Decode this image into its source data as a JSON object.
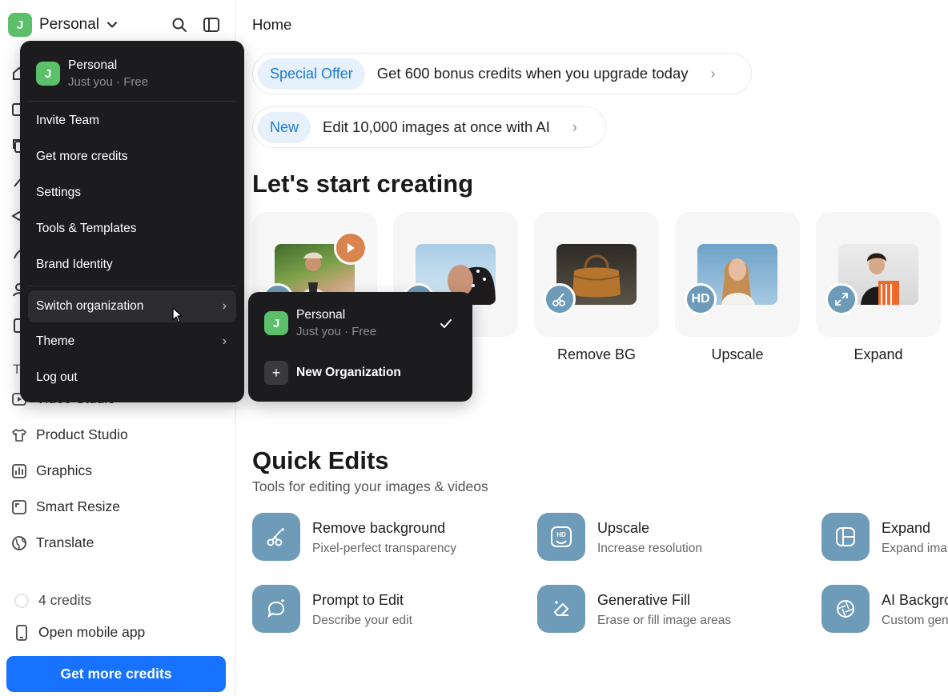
{
  "header": {
    "workspace_initial": "J",
    "workspace_name": "Personal"
  },
  "sidebar": {
    "visible_items": [
      {
        "label": "Video Studio",
        "icon": "video-icon"
      },
      {
        "label": "Product Studio",
        "icon": "shirt-icon"
      },
      {
        "label": "Graphics",
        "icon": "chart-icon"
      },
      {
        "label": "Smart Resize",
        "icon": "resize-icon"
      },
      {
        "label": "Translate",
        "icon": "globe-icon"
      }
    ],
    "section_letter": "T",
    "credits": "4 credits",
    "mobile": "Open mobile app",
    "cta": "Get more credits"
  },
  "main": {
    "title": "Home",
    "promos": [
      {
        "badge": "Special Offer",
        "text": "Get 600 bonus credits when you upgrade today"
      },
      {
        "badge": "New",
        "text": "Edit 10,000 images at once with AI"
      }
    ],
    "start_heading": "Let's start creating",
    "tools": [
      {
        "label": "",
        "badge": ""
      },
      {
        "label": "",
        "badge": ""
      },
      {
        "label": "Remove BG",
        "badge": ""
      },
      {
        "label": "Upscale",
        "badge": "HD"
      },
      {
        "label": "Expand",
        "badge": ""
      }
    ],
    "quick_heading": "Quick Edits",
    "quick_sub": "Tools for editing your images & videos",
    "quick_edits": [
      {
        "title": "Remove background",
        "desc": "Pixel-perfect transparency",
        "icon": "magic-scissors-icon"
      },
      {
        "title": "Upscale",
        "desc": "Increase resolution",
        "icon": "hd-icon"
      },
      {
        "title": "Expand",
        "desc": "Expand ima",
        "icon": "expand-layout-icon"
      },
      {
        "title": "Prompt to Edit",
        "desc": "Describe your edit",
        "icon": "chat-sparkle-icon"
      },
      {
        "title": "Generative Fill",
        "desc": "Erase or fill image areas",
        "icon": "eraser-icon"
      },
      {
        "title": "AI Backgro",
        "desc": "Custom gen",
        "icon": "aperture-icon"
      }
    ]
  },
  "account_menu": {
    "name": "Personal",
    "sub": "Just you · Free",
    "items": [
      "Invite Team",
      "Get more credits",
      "Settings",
      "Tools & Templates",
      "Brand Identity",
      "Switch organization",
      "Theme",
      "Log out"
    ]
  },
  "org_submenu": {
    "name": "Personal",
    "sub": "Just you · Free",
    "new_org": "New Organization"
  },
  "colors": {
    "accent": "#1672ff",
    "avatar": "#5cc06a",
    "tool_icon": "#6d9bb8",
    "menu_bg": "#1c1c1e"
  }
}
